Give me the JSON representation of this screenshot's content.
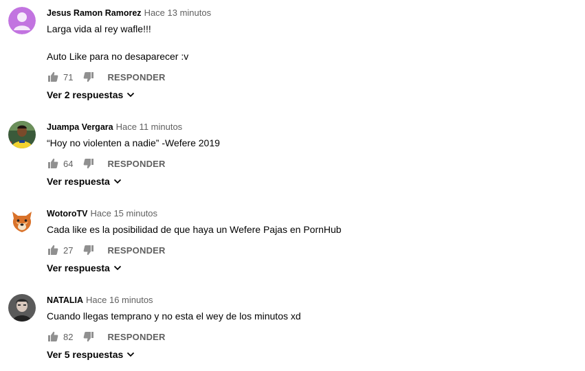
{
  "comments": [
    {
      "author": "Jesus Ramon Ramorez",
      "time": "Hace 13 minutos",
      "text": "Larga vida al rey wafle!!!\n\nAuto Like para no desaparecer :v",
      "likes": "71",
      "reply_label": "RESPONDER",
      "replies_label": "Ver 2 respuestas",
      "avatar_icon": "default-user-icon"
    },
    {
      "author": "Juampa Vergara",
      "time": "Hace 11 minutos",
      "text": "“Hoy no violenten a nadie” -Wefere 2019",
      "likes": "64",
      "reply_label": "RESPONDER",
      "replies_label": "Ver respuesta",
      "avatar_icon": "soccer-player-photo"
    },
    {
      "author": "WotoroTV",
      "time": "Hace 15 minutos",
      "text": "Cada like es la posibilidad de que haya un Wefere Pajas en PornHub",
      "likes": "27",
      "reply_label": "RESPONDER",
      "replies_label": "Ver respuesta",
      "avatar_icon": "cartoon-bear-icon"
    },
    {
      "author": "NATALIA",
      "time": "Hace 16 minutos",
      "text": "Cuando llegas temprano y no esta el wey de los minutos xd",
      "likes": "82",
      "reply_label": "RESPONDER",
      "replies_label": "Ver 5 respuestas",
      "avatar_icon": "user-photo"
    }
  ],
  "colors": {
    "text_primary": "#030303",
    "text_secondary": "#606060",
    "icon": "#909090",
    "default_avatar": "#c87de8"
  }
}
